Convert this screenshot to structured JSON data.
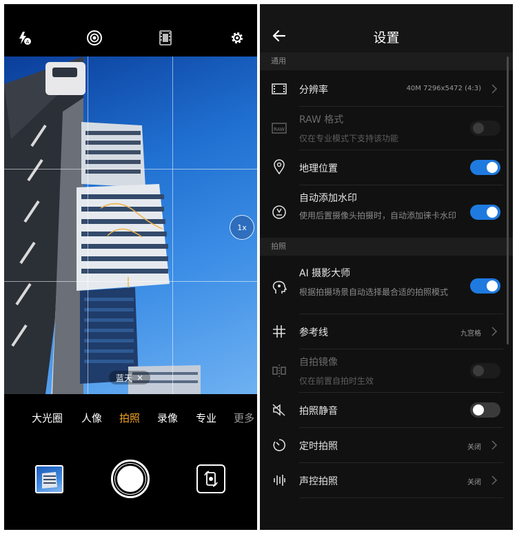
{
  "camera": {
    "top_icons": [
      "flash-auto-icon",
      "ai-lens-icon",
      "film-icon",
      "gear-icon"
    ],
    "zoom_label": "1x",
    "scene_tag": "蓝天",
    "scene_close": "×",
    "modes": [
      {
        "label": "大光圈"
      },
      {
        "label": "人像"
      },
      {
        "label": "拍照"
      },
      {
        "label": "录像"
      },
      {
        "label": "专业"
      },
      {
        "label": "更多"
      }
    ],
    "active_mode": "拍照",
    "colors": {
      "accent": "#f5a623"
    }
  },
  "settings": {
    "title": "设置",
    "section_general": "通用",
    "section_photo": "拍照",
    "resolution": {
      "title": "分辨率",
      "value": "40M 7296x5472 (4:3)"
    },
    "raw": {
      "title": "RAW 格式",
      "sub": "仅在专业模式下支持该功能",
      "state": "disabled"
    },
    "location": {
      "title": "地理位置",
      "state": "on"
    },
    "watermark": {
      "title": "自动添加水印",
      "sub": "使用后置摄像头拍摄时，自动添加徕卡水印",
      "state": "on"
    },
    "ai_master": {
      "title": "AI 摄影大师",
      "sub": "根据拍摄场景自动选择最合适的拍照模式",
      "state": "on"
    },
    "gridlines": {
      "title": "参考线",
      "value": "九宫格"
    },
    "mirror": {
      "title": "自拍镜像",
      "sub": "仅在前置自拍时生效",
      "state": "disabled"
    },
    "mute": {
      "title": "拍照静音",
      "state": "off"
    },
    "timer": {
      "title": "定时拍照",
      "value": "关闭"
    },
    "voice": {
      "title": "声控拍照",
      "value": "关闭"
    },
    "colors": {
      "toggle_on": "#1f7ae0",
      "background": "#111111"
    }
  }
}
